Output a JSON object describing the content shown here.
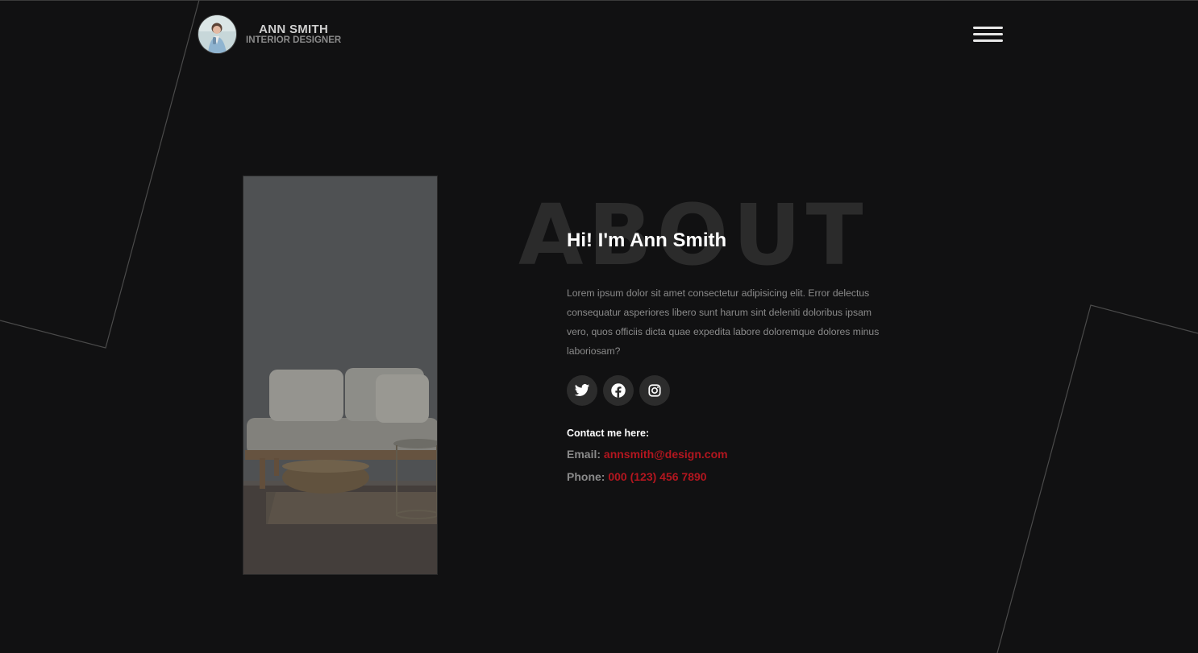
{
  "header": {
    "name": "ANN SMITH",
    "role": "INTERIOR DESIGNER",
    "menu_icon": "hamburger-menu-icon"
  },
  "about": {
    "background_word": "ABOUT",
    "heading": "Hi! I'm Ann Smith",
    "body": "Lorem ipsum dolor sit amet consectetur adipisicing elit. Error delectus consequatur asperiores libero sunt harum sint deleniti doloribus ipsam vero, quos officiis dicta quae expedita labore doloremque dolores minus laboriosam?"
  },
  "socials": [
    {
      "icon": "twitter-icon"
    },
    {
      "icon": "facebook-icon"
    },
    {
      "icon": "instagram-icon"
    }
  ],
  "contact": {
    "title": "Contact me here:",
    "email_label": "Email:",
    "email_value": "annsmith@design.com",
    "phone_label": "Phone:",
    "phone_value": "000 (123) 456 7890"
  },
  "colors": {
    "background": "#111112",
    "accent": "#b3161f",
    "heading": "#ffffff",
    "muted_text": "#8a8a8a",
    "social_bg": "#2c2c2c"
  }
}
